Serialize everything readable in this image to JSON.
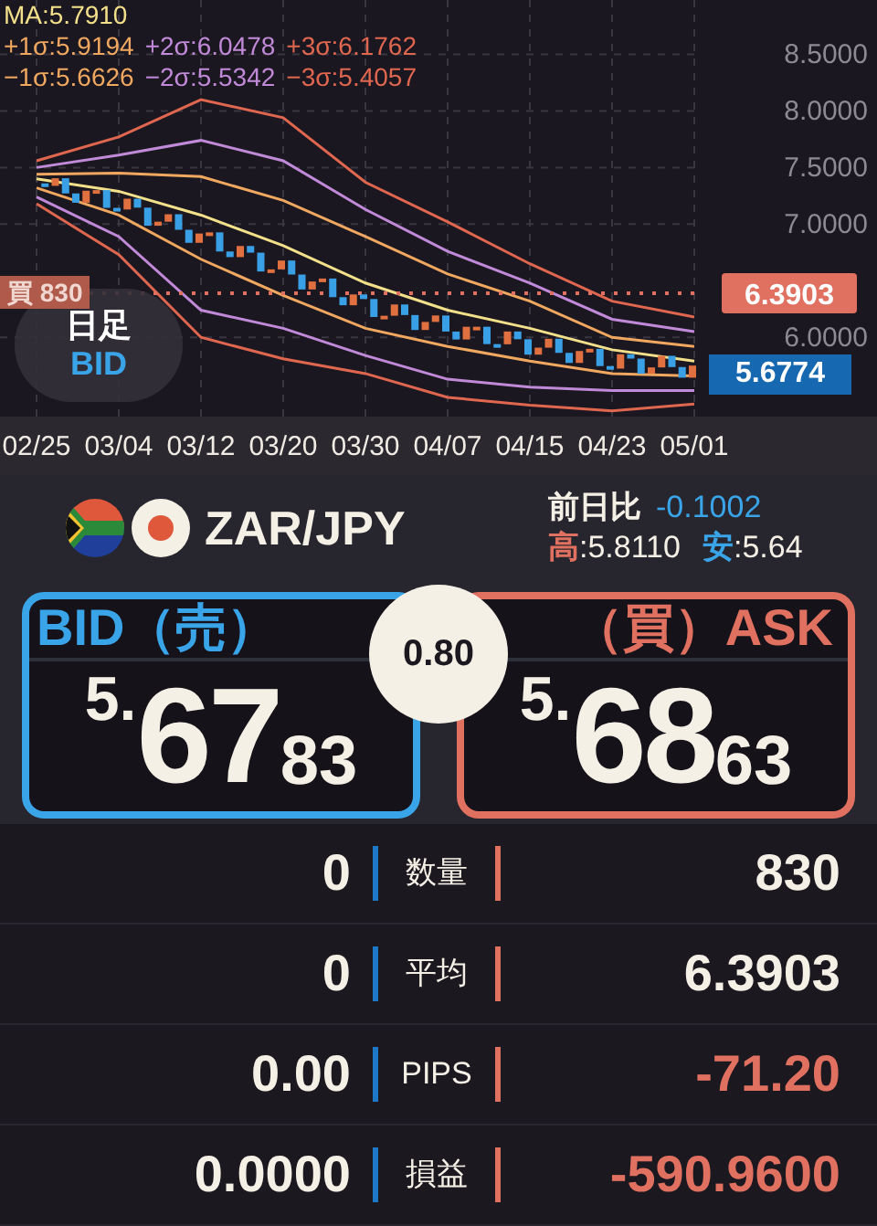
{
  "chart": {
    "legend_values": [
      ":5.7910",
      ":5.9194",
      ":6.0478",
      ":6.1762",
      ":5.6626",
      ":5.5342",
      ":5.4057"
    ],
    "position_tag": "買 830",
    "current_price": "5.6774",
    "timeframe": "日足",
    "side": "BID",
    "chart_data": {
      "type": "line",
      "grid": true,
      "categories": [
        "02/25",
        "03/04",
        "03/12",
        "03/20",
        "03/30",
        "04/07",
        "04/15",
        "04/23",
        "05/01"
      ],
      "ylim": [
        5.3,
        8.98
      ],
      "yticks": [
        {
          "value": 6,
          "label": "6.0000"
        },
        {
          "value": 7,
          "label": "7.0000"
        },
        {
          "value": 7.5,
          "label": "7.5000"
        },
        {
          "value": 8,
          "label": "8.0000"
        },
        {
          "value": 8.5,
          "label": "8.5000"
        }
      ],
      "series": [
        {
          "name": "MA",
          "color": "#f3e08a",
          "values": [
            7.4,
            7.29,
            7.08,
            6.81,
            6.48,
            6.24,
            6.08,
            5.89,
            5.79
          ]
        },
        {
          "name": "+1σ",
          "color": "#f0a860",
          "values": [
            7.44,
            7.45,
            7.42,
            7.21,
            6.89,
            6.56,
            6.32,
            6.0,
            5.92
          ]
        },
        {
          "name": "+2σ",
          "color": "#c08ad8",
          "values": [
            7.5,
            7.61,
            7.74,
            7.56,
            7.13,
            6.76,
            6.48,
            6.16,
            6.05
          ]
        },
        {
          "name": "+3σ",
          "color": "#e0674f",
          "values": [
            7.56,
            7.77,
            8.1,
            7.94,
            7.37,
            7.02,
            6.65,
            6.32,
            6.18
          ]
        },
        {
          "name": "−1σ",
          "color": "#f0a860",
          "values": [
            7.32,
            7.08,
            6.69,
            6.37,
            6.08,
            5.92,
            5.79,
            5.68,
            5.66
          ]
        },
        {
          "name": "−2σ",
          "color": "#c08ad8",
          "values": [
            7.24,
            6.89,
            6.24,
            6.08,
            5.84,
            5.63,
            5.56,
            5.53,
            5.53
          ]
        },
        {
          "name": "−3σ",
          "color": "#e0674f",
          "values": [
            7.18,
            6.73,
            6.0,
            5.81,
            5.68,
            5.47,
            5.4,
            5.35,
            5.41
          ]
        }
      ],
      "ref_lines": [
        {
          "axis": "y",
          "value": 6.3903,
          "label": "6.3903",
          "color": "#e07060"
        }
      ]
    }
  },
  "pair": {
    "name": "ZAR/JPY",
    "change_label": "前日比",
    "change": "-0.1002",
    "high_label": "高",
    "high": ":5.8110",
    "low_label": "安",
    "low": ":5.64"
  },
  "bid": {
    "label": "BID（売）",
    "price_head": "5.",
    "price_main": "67",
    "price_tail": "83"
  },
  "ask": {
    "label": "（買）ASK",
    "price_head": "5.",
    "price_main": "68",
    "price_tail": "63"
  },
  "spread": "0.80",
  "rows": [
    {
      "bid": "0",
      "label": "数量",
      "ask": "830",
      "negative": false
    },
    {
      "bid": "0",
      "label": "平均",
      "ask": "6.3903",
      "negative": false
    },
    {
      "bid": "0.00",
      "label": "PIPS",
      "ask": "-71.20",
      "negative": true
    },
    {
      "bid": "0.0000",
      "label": "損益",
      "ask": "-590.9600",
      "negative": true
    }
  ]
}
